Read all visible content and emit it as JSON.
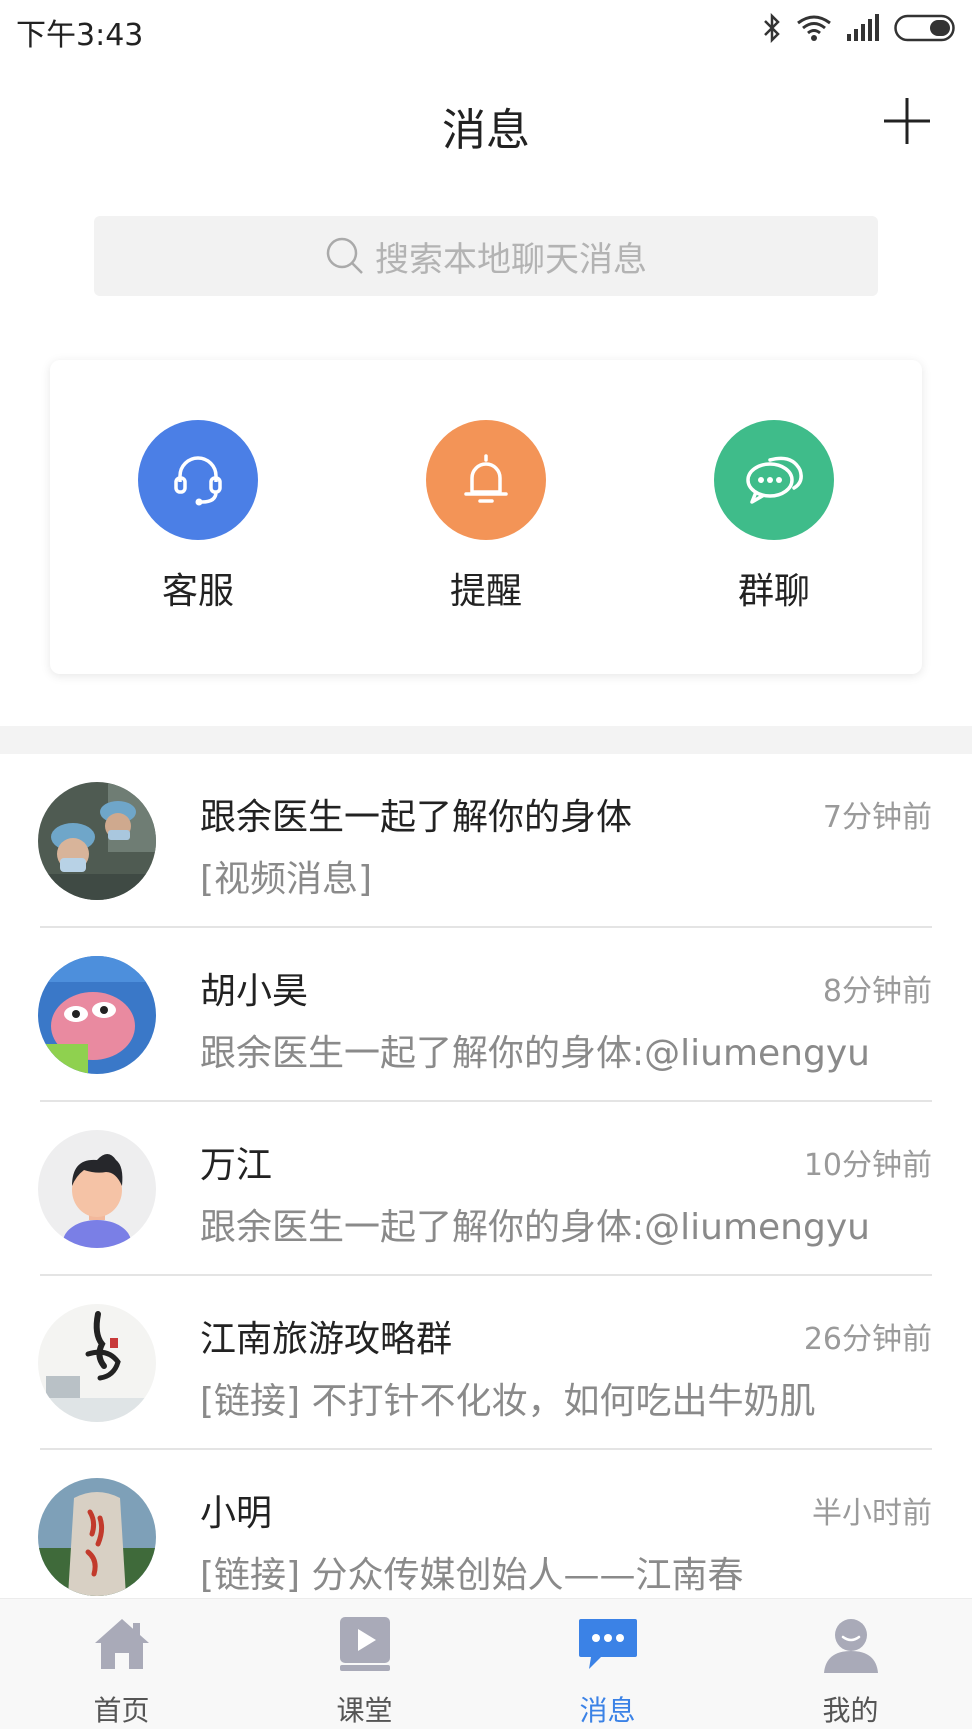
{
  "status_bar": {
    "time": "下午3:43"
  },
  "header": {
    "title": "消息"
  },
  "search": {
    "placeholder": "搜索本地聊天消息"
  },
  "quick_actions": [
    {
      "label": "客服",
      "icon": "headset-icon",
      "color": "#4b7fe6"
    },
    {
      "label": "提醒",
      "icon": "bell-icon",
      "color": "#f39457"
    },
    {
      "label": "群聊",
      "icon": "chat-bubble-icon",
      "color": "#3fbc8a"
    }
  ],
  "conversations": [
    {
      "name": "跟余医生一起了解你的身体",
      "time": "7分钟前",
      "message": "[视频消息]"
    },
    {
      "name": "胡小昊",
      "time": "8分钟前",
      "message": "跟余医生一起了解你的身体:@liumengyu"
    },
    {
      "name": "万江",
      "time": "10分钟前",
      "message": "跟余医生一起了解你的身体:@liumengyu"
    },
    {
      "name": "江南旅游攻略群",
      "time": "26分钟前",
      "message": "[链接] 不打针不化妆，如何吃出牛奶肌"
    },
    {
      "name": "小明",
      "time": "半小时前",
      "message": "[链接] 分众传媒创始人——江南春"
    }
  ],
  "tabbar": {
    "tabs": [
      {
        "label": "首页",
        "icon": "home-icon"
      },
      {
        "label": "课堂",
        "icon": "classroom-video-icon"
      },
      {
        "label": "消息",
        "icon": "message-icon",
        "active": true
      },
      {
        "label": "我的",
        "icon": "profile-icon"
      }
    ],
    "active_color": "#3b82e6",
    "inactive_color": "#a9aab8"
  }
}
